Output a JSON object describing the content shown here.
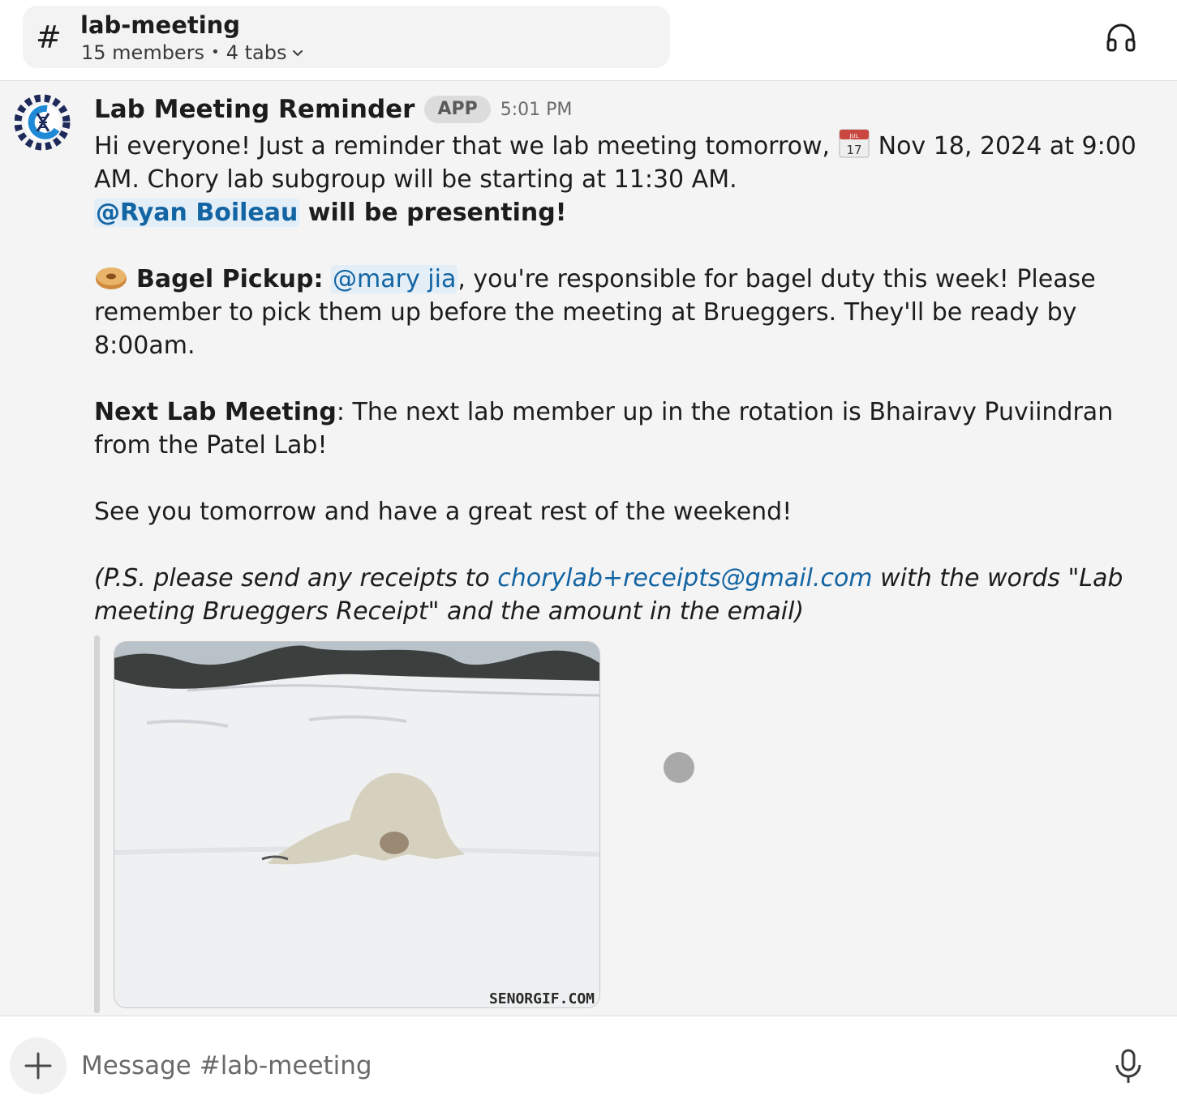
{
  "header": {
    "channel_name": "lab-meeting",
    "member_count": "15 members",
    "separator": "•",
    "tab_count": "4 tabs"
  },
  "message": {
    "sender": "Lab Meeting Reminder",
    "badge": "APP",
    "time": "5:01 PM",
    "line1_text": "Hi everyone! Just a reminder that we lab meeting tomorrow, ",
    "calendar_month": "JUL",
    "calendar_day": "17",
    "line1_date": "Nov 18, 2024 at 9:00 AM.",
    "line1_rest": " Chory lab subgroup will be starting at 11:30 AM.",
    "presenter_mention": "@Ryan Boileau",
    "presenter_text": " will be presenting!",
    "bagel_label": "Bagel Pickup:",
    "bagel_mention": "@mary jia",
    "bagel_text": ", you're responsible for bagel duty this week! Please remember to pick them up before the meeting at Brueggers. They'll be ready by 8:00am.",
    "next_label": "Next Lab Meeting",
    "next_text": ": The next lab member up in the rotation is Bhairavy Puviindran from the Patel Lab!",
    "closing": "See you tomorrow and have a great rest of the weekend!",
    "ps_before": "(P.S. please send any receipts to ",
    "ps_email": "chorylab+receipts@gmail.com",
    "ps_after": " with the words \"Lab meeting Brueggers Receipt\" and the amount in the email)",
    "gif_watermark": "SENORGIF.COM"
  },
  "composer": {
    "placeholder": "Message #lab-meeting"
  },
  "colors": {
    "link": "#1264a3",
    "mention_bg": "#e3eef7",
    "message_bg": "#f4f4f4"
  }
}
